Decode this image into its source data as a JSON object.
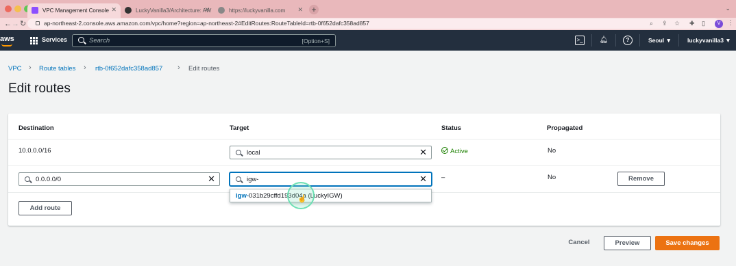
{
  "browser": {
    "tabs": [
      {
        "title": "VPC Management Console",
        "active": true
      },
      {
        "title": "LuckyVanilla3/Architecture: AW",
        "active": false
      },
      {
        "title": "https://luckyvanilla.com",
        "active": false
      }
    ],
    "url": "ap-northeast-2.console.aws.amazon.com/vpc/home?region=ap-northeast-2#EditRoutes:RouteTableId=rtb-0f652dafc358ad857",
    "profile_initial": "V"
  },
  "aws_nav": {
    "logo": "aws",
    "services_label": "Services",
    "search_placeholder": "Search",
    "search_shortcut": "[Option+S]",
    "region": "Seoul ▼",
    "account": "luckyvanilla3 ▼"
  },
  "breadcrumb": {
    "items": [
      "VPC",
      "Route tables",
      "rtb-0f652dafc358ad857",
      "Edit routes"
    ],
    "separator": "›"
  },
  "page_title": "Edit routes",
  "table": {
    "headers": {
      "destination": "Destination",
      "target": "Target",
      "status": "Status",
      "propagated": "Propagated"
    },
    "rows": [
      {
        "destination": "10.0.0.0/16",
        "target": "local",
        "status": "Active",
        "propagated": "No"
      },
      {
        "destination": "0.0.0.0/0",
        "target": "igw-",
        "status": "–",
        "propagated": "No",
        "remove_label": "Remove"
      }
    ],
    "suggestion": {
      "prefix": "igw-",
      "rest": "031b29cffd193d04a (LuckyIGW)"
    },
    "add_route_label": "Add route"
  },
  "footer": {
    "cancel_label": "Cancel",
    "preview_label": "Preview",
    "save_label": "Save changes"
  },
  "colors": {
    "aws_nav": "#232f3e",
    "primary": "#ec7211",
    "link": "#0073bb",
    "success": "#1d8102",
    "browser_tint": "#e9b8bb"
  }
}
